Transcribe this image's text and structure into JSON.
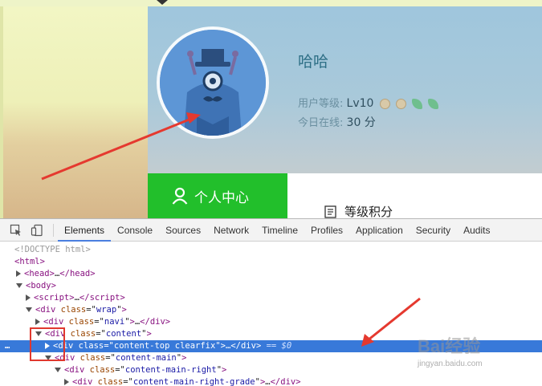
{
  "profile": {
    "username": "哈哈",
    "level_label": "用户等级:",
    "level_value": "Lv10",
    "online_label": "今日在线:",
    "online_value": "30 分",
    "personal_center": "个人中心",
    "grade_points": "等级积分",
    "colors": {
      "banner": "#a3c7dc",
      "button": "#22bf2b",
      "avatar": "#5d96d6"
    }
  },
  "devtools": {
    "tabs": [
      "Elements",
      "Console",
      "Sources",
      "Network",
      "Timeline",
      "Profiles",
      "Application",
      "Security",
      "Audits"
    ],
    "active_tab": "Elements",
    "tree": [
      {
        "tag_open": "<!DOCTYPE html>"
      },
      {
        "tag": "html"
      },
      {
        "tag": "head",
        "collapsed": "…"
      },
      {
        "tag": "body"
      },
      {
        "tag": "script",
        "collapsed": "…"
      },
      {
        "tag": "div",
        "attr": "class",
        "value": "wrap"
      },
      {
        "tag": "div",
        "attr": "class",
        "value": "navi",
        "collapsed": "…"
      },
      {
        "tag": "div",
        "attr": "class",
        "value": "content"
      },
      {
        "tag": "div",
        "attr": "class",
        "value": "content-top clearfix",
        "collapsed": "…",
        "console_ref": "== $0"
      },
      {
        "tag": "div",
        "attr": "class",
        "value": "content-main"
      },
      {
        "tag": "div",
        "attr": "class",
        "value": "content-main-right"
      },
      {
        "tag": "div",
        "attr": "class",
        "value": "content-main-right-grade",
        "collapsed": "…"
      }
    ],
    "selected_dots": "…",
    "accent": "#3879d9"
  },
  "watermark": {
    "brand": "Bai经验",
    "url": "jingyan.baidu.com"
  }
}
